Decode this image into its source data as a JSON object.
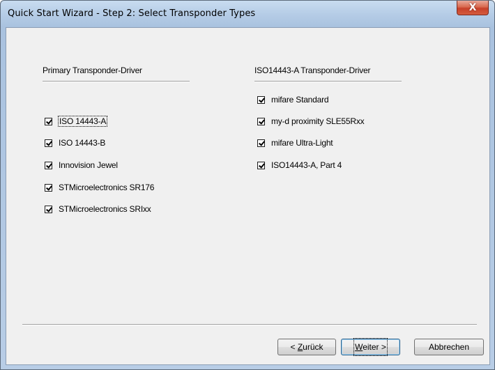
{
  "window": {
    "title": "Quick Start Wizard - Step 2: Select Transponder Types",
    "close_glyph": "X"
  },
  "left_group": {
    "title": "Primary Transponder-Driver",
    "items": [
      {
        "label": "ISO 14443-A",
        "checked": true
      },
      {
        "label": "ISO 14443-B",
        "checked": true
      },
      {
        "label": "Innovision Jewel",
        "checked": true
      },
      {
        "label": "STMicroelectronics SR176",
        "checked": true
      },
      {
        "label": "STMicroelectronics SRIxx",
        "checked": true
      }
    ]
  },
  "right_group": {
    "title": "ISO14443-A Transponder-Driver",
    "items": [
      {
        "label": "mifare Standard",
        "checked": true
      },
      {
        "label": "my-d proximity SLE55Rxx",
        "checked": true
      },
      {
        "label": "mifare Ultra-Light",
        "checked": true
      },
      {
        "label": "ISO14443-A, Part 4",
        "checked": true
      }
    ]
  },
  "buttons": {
    "back_prefix": "< ",
    "back_mnemonic": "Z",
    "back_rest": "urück",
    "next_mnemonic": "W",
    "next_rest": "eiter >",
    "cancel": "Abbrechen"
  },
  "colors": {
    "title_gradient_top": "#c9dcf0",
    "client_bg": "#f0f0f0",
    "close_red": "#c7402a"
  }
}
